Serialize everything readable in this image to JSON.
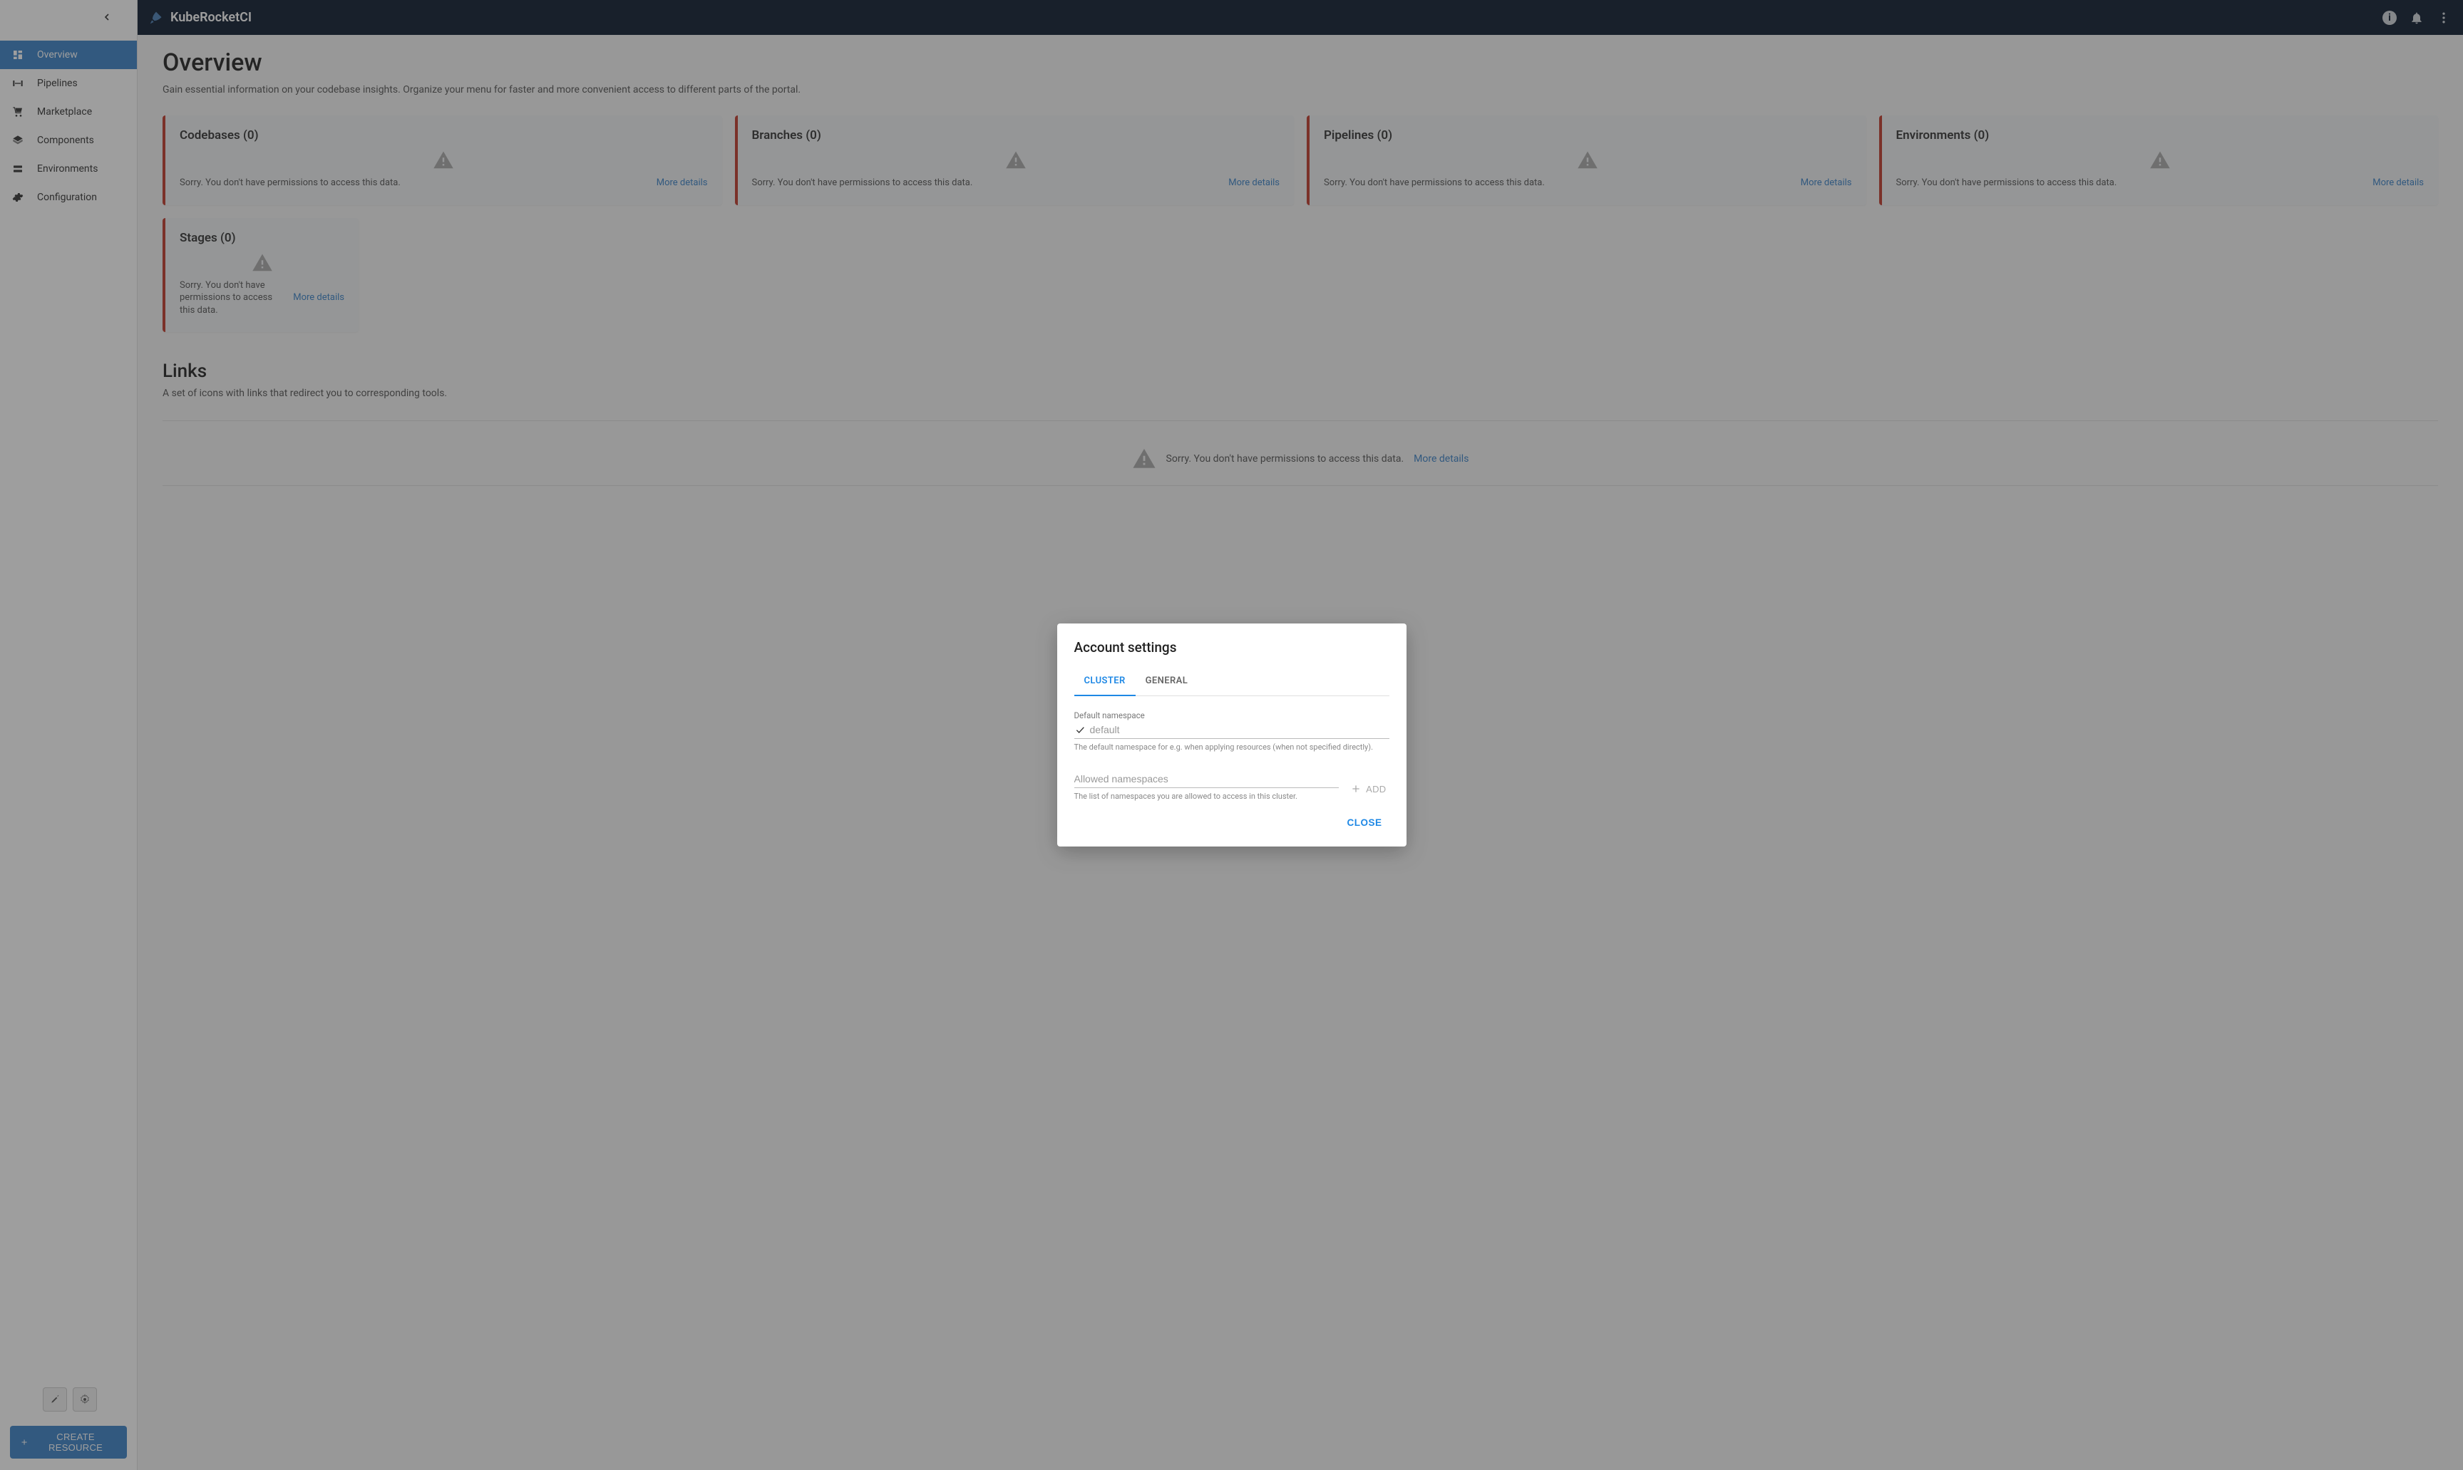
{
  "brand": "KubeRocketCI",
  "sidebar": {
    "items": [
      {
        "label": "Overview"
      },
      {
        "label": "Pipelines"
      },
      {
        "label": "Marketplace"
      },
      {
        "label": "Components"
      },
      {
        "label": "Environments"
      },
      {
        "label": "Configuration"
      }
    ],
    "create_label": "CREATE RESOURCE"
  },
  "page": {
    "title": "Overview",
    "subtitle": "Gain essential information on your codebase insights. Organize your menu for faster and more convenient access to different parts of the portal."
  },
  "cards": [
    {
      "title": "Codebases (0)"
    },
    {
      "title": "Branches (0)"
    },
    {
      "title": "Pipelines (0)"
    },
    {
      "title": "Environments (0)"
    },
    {
      "title": "Stages (0)"
    }
  ],
  "card_error": "Sorry. You don't have permissions to access this data.",
  "more_details": "More details",
  "links": {
    "title": "Links",
    "subtitle": "A set of icons with links that redirect you to corresponding tools.",
    "empty_msg": "Sorry. You don't have permissions to access this data.",
    "empty_link": "More details"
  },
  "modal": {
    "title": "Account settings",
    "tabs": [
      {
        "label": "CLUSTER"
      },
      {
        "label": "GENERAL"
      }
    ],
    "default_ns": {
      "label": "Default namespace",
      "value": "default",
      "help": "The default namespace for e.g. when applying resources (when not specified directly)."
    },
    "allowed_ns": {
      "placeholder": "Allowed namespaces",
      "help": "The list of namespaces you are allowed to access in this cluster.",
      "add_label": "ADD"
    },
    "close_label": "CLOSE"
  }
}
